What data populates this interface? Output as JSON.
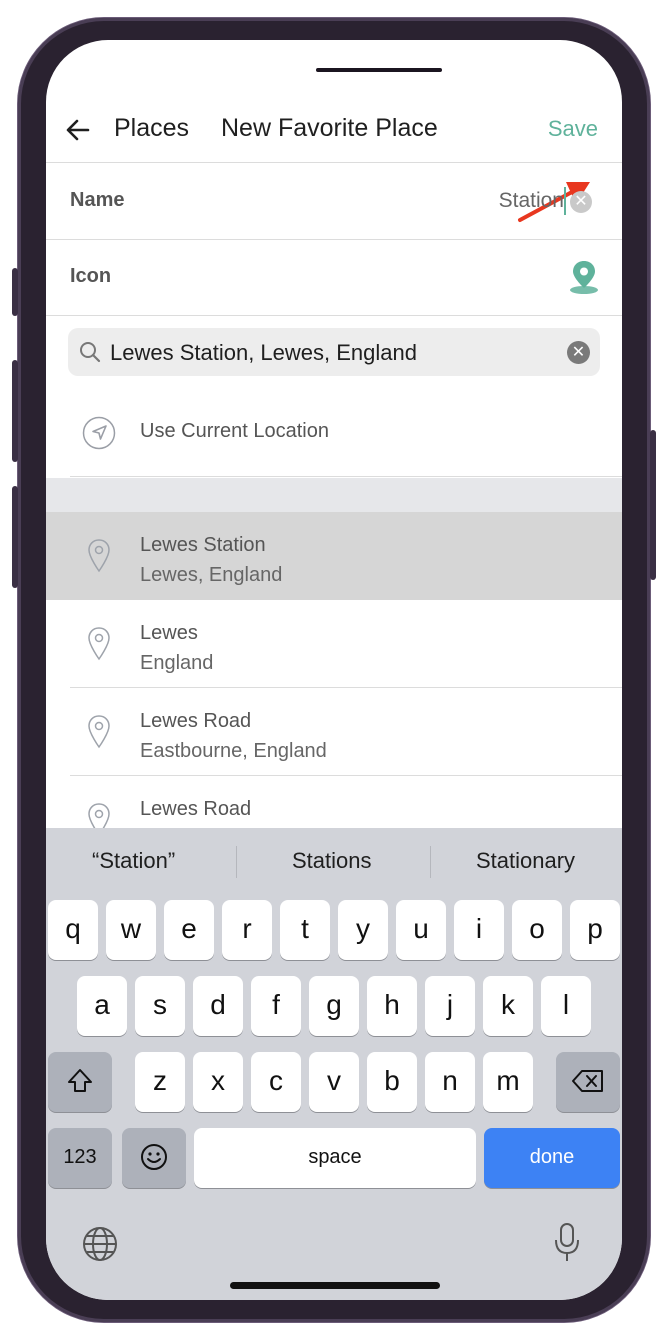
{
  "nav": {
    "back_label": "Places",
    "title": "New Favorite Place",
    "save_label": "Save"
  },
  "form": {
    "name_label": "Name",
    "name_value": "Station",
    "icon_label": "Icon"
  },
  "search": {
    "value": "Lewes Station, Lewes, England"
  },
  "current_location_label": "Use Current Location",
  "results": [
    {
      "title": "Lewes Station",
      "subtitle": "Lewes, England"
    },
    {
      "title": "Lewes",
      "subtitle": "England"
    },
    {
      "title": "Lewes Road",
      "subtitle": "Eastbourne, England"
    },
    {
      "title": "Lewes Road",
      "subtitle": ""
    }
  ],
  "keyboard": {
    "suggestions": [
      "“Station”",
      "Stations",
      "Stationary"
    ],
    "row1": [
      "q",
      "w",
      "e",
      "r",
      "t",
      "y",
      "u",
      "i",
      "o",
      "p"
    ],
    "row2": [
      "a",
      "s",
      "d",
      "f",
      "g",
      "h",
      "j",
      "k",
      "l"
    ],
    "row3": [
      "z",
      "x",
      "c",
      "v",
      "b",
      "n",
      "m"
    ],
    "numbers_label": "123",
    "space_label": "space",
    "done_label": "done"
  },
  "colors": {
    "accent": "#5fb29b",
    "annotation_arrow": "#e8371f",
    "keyboard_done": "#3d82f4"
  }
}
